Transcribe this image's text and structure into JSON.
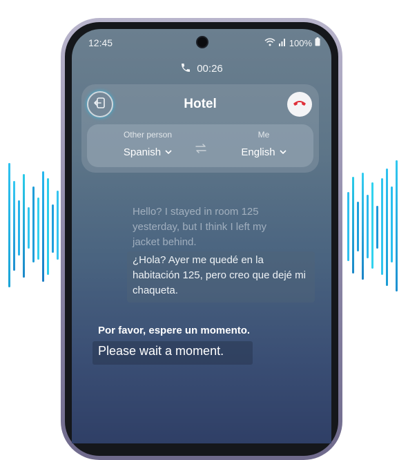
{
  "status_bar": {
    "time": "12:45",
    "battery": "100%",
    "icons": [
      "wifi-icon",
      "signal-icon",
      "battery-icon"
    ]
  },
  "call": {
    "duration": "00:26"
  },
  "header": {
    "title": "Hotel",
    "exit_icon": "exit-icon",
    "end_call_icon": "end-call-icon"
  },
  "languages": {
    "other_label": "Other person",
    "other_value": "Spanish",
    "me_label": "Me",
    "me_value": "English",
    "swap_icon": "swap-icon"
  },
  "transcript": {
    "original": "Hello? I stayed in room 125 yesterday, but I think I left my jacket behind.",
    "translated": "¿Hola? Ayer me quedé en la habitación 125, pero creo que dejé mi chaqueta."
  },
  "reply": {
    "spanish": "Por favor, espere un momento.",
    "english": "Please wait a moment."
  },
  "colors": {
    "end_call": "#e0303a",
    "wave": "#2fb8e8"
  }
}
